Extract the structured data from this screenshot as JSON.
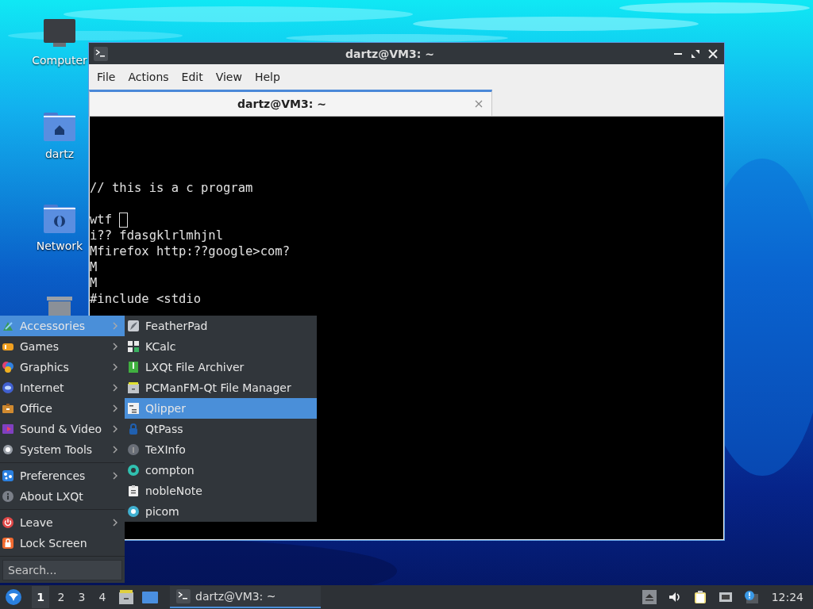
{
  "desktop": {
    "icons": [
      {
        "kind": "computer",
        "label": "Computer"
      },
      {
        "kind": "home",
        "label": "dartz"
      },
      {
        "kind": "network",
        "label": "Network"
      },
      {
        "kind": "trash"
      }
    ]
  },
  "window": {
    "title": "dartz@VM3: ~",
    "menu": [
      "File",
      "Actions",
      "Edit",
      "View",
      "Help"
    ],
    "tabs": [
      {
        "label": "dartz@VM3: ~",
        "selected": true
      }
    ],
    "terminal_lines": [
      {
        "text": "// this is a c program",
        "cursor": false
      },
      {
        "cursor": false
      },
      {
        "text": "wtf ",
        "cursor": true
      },
      {
        "text": "i?? fdasgklrlmhjnl",
        "cursor": false
      },
      {
        "text": "Mfirefox http:??google>com?",
        "cursor": false
      },
      {
        "text": "M",
        "cursor": false
      },
      {
        "text": "M",
        "cursor": false
      },
      {
        "text": "#include <stdio",
        "cursor": false
      }
    ]
  },
  "start_menu": {
    "groups": [
      [
        {
          "label": "Accessories",
          "submenu": true,
          "selected": true
        },
        {
          "label": "Games",
          "submenu": true,
          "selected": false
        },
        {
          "label": "Graphics",
          "submenu": true,
          "selected": false
        },
        {
          "label": "Internet",
          "submenu": true,
          "selected": false
        },
        {
          "label": "Office",
          "submenu": true,
          "selected": false
        },
        {
          "label": "Sound & Video",
          "submenu": true,
          "selected": false
        },
        {
          "label": "System Tools",
          "submenu": true,
          "selected": false
        }
      ],
      [
        {
          "label": "Preferences",
          "submenu": true,
          "selected": false
        },
        {
          "label": "About LXQt",
          "submenu": false,
          "selected": false
        }
      ],
      [
        {
          "label": "Leave",
          "submenu": true,
          "selected": false
        },
        {
          "label": "Lock Screen",
          "submenu": false,
          "selected": false
        }
      ]
    ],
    "search": {
      "placeholder": "Search..."
    },
    "submenu": [
      {
        "label": "FeatherPad",
        "selected": false
      },
      {
        "label": "KCalc",
        "selected": false
      },
      {
        "label": "LXQt File Archiver",
        "selected": false
      },
      {
        "label": "PCManFM-Qt File Manager",
        "selected": false
      },
      {
        "label": "Qlipper",
        "selected": true
      },
      {
        "label": "QtPass",
        "selected": false
      },
      {
        "label": "TeXInfo",
        "selected": false
      },
      {
        "label": "compton",
        "selected": false
      },
      {
        "label": "nobleNote",
        "selected": false
      },
      {
        "label": "picom",
        "selected": false
      }
    ]
  },
  "taskbar": {
    "desktops": [
      {
        "label": "1",
        "selected": true
      },
      {
        "label": "2",
        "selected": false
      },
      {
        "label": "3",
        "selected": false
      },
      {
        "label": "4",
        "selected": false
      }
    ],
    "tasks": [
      {
        "label": "dartz@VM3: ~",
        "selected": true
      }
    ],
    "clock": "12:24"
  }
}
